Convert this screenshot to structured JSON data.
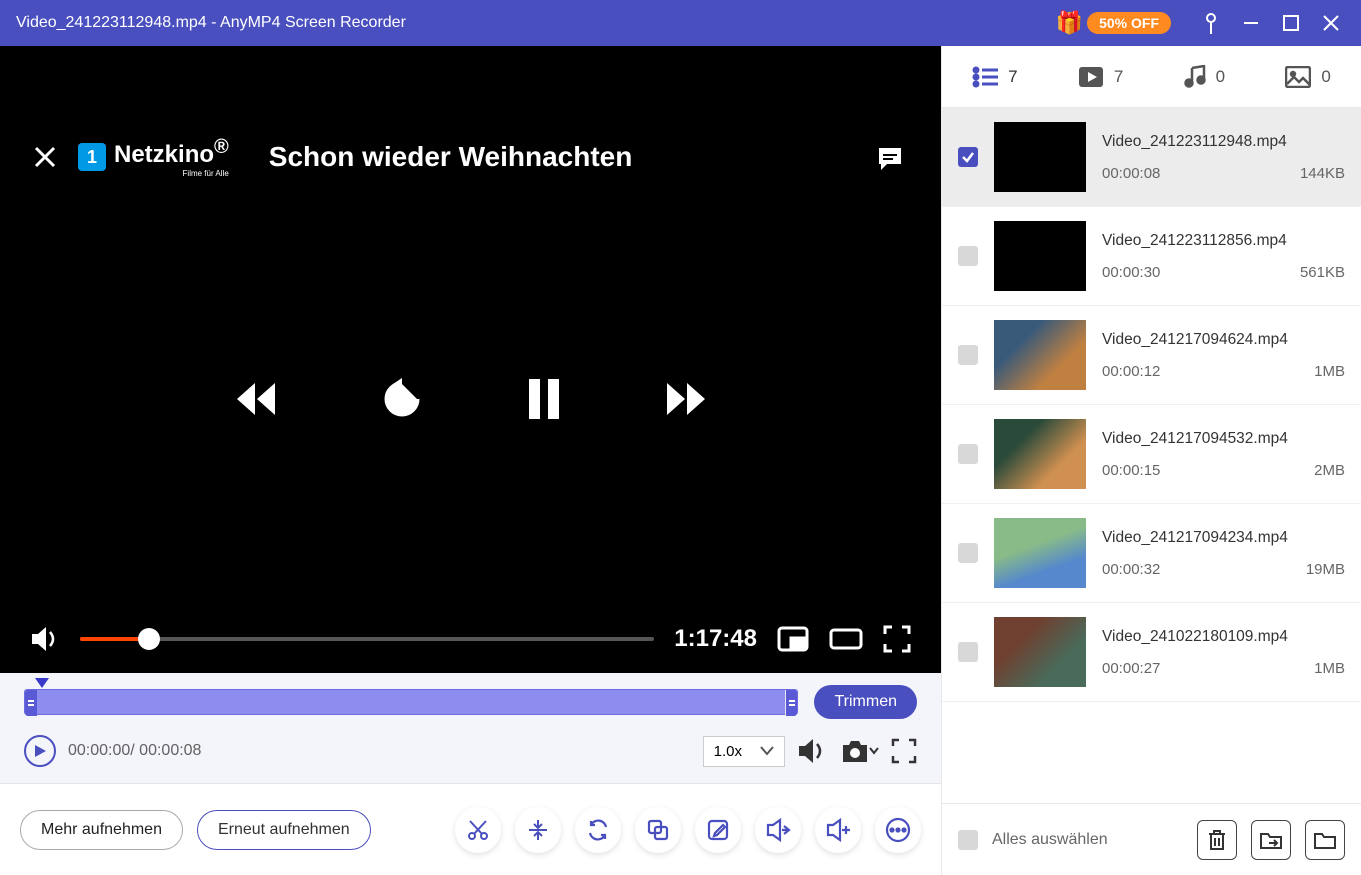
{
  "titlebar": {
    "title": "Video_241223112948.mp4  -  AnyMP4 Screen Recorder",
    "promo": "50% OFF"
  },
  "player": {
    "brand_prefix": "1",
    "brand": "Netzkino",
    "brand_sub": "Filme für Alle",
    "movie_title": "Schon wieder Weihnachten",
    "time": "1:17:48"
  },
  "trim": {
    "button": "Trimmen",
    "range": "00:00:00/ 00:00:08",
    "speed": "1.0x"
  },
  "footer": {
    "more": "Mehr aufnehmen",
    "rerecord": "Erneut aufnehmen"
  },
  "sidebar": {
    "tabs": {
      "all": "7",
      "video": "7",
      "audio": "0",
      "image": "0"
    },
    "select_all": "Alles auswählen",
    "items": [
      {
        "filename": "Video_241223112948.mp4",
        "duration": "00:00:08",
        "size": "144KB",
        "checked": true,
        "thumbClass": "c1"
      },
      {
        "filename": "Video_241223112856.mp4",
        "duration": "00:00:30",
        "size": "561KB",
        "checked": false,
        "thumbClass": "c2"
      },
      {
        "filename": "Video_241217094624.mp4",
        "duration": "00:00:12",
        "size": "1MB",
        "checked": false,
        "thumbClass": "c3"
      },
      {
        "filename": "Video_241217094532.mp4",
        "duration": "00:00:15",
        "size": "2MB",
        "checked": false,
        "thumbClass": "c4"
      },
      {
        "filename": "Video_241217094234.mp4",
        "duration": "00:00:32",
        "size": "19MB",
        "checked": false,
        "thumbClass": "c5"
      },
      {
        "filename": "Video_241022180109.mp4",
        "duration": "00:00:27",
        "size": "1MB",
        "checked": false,
        "thumbClass": "c6"
      }
    ]
  }
}
